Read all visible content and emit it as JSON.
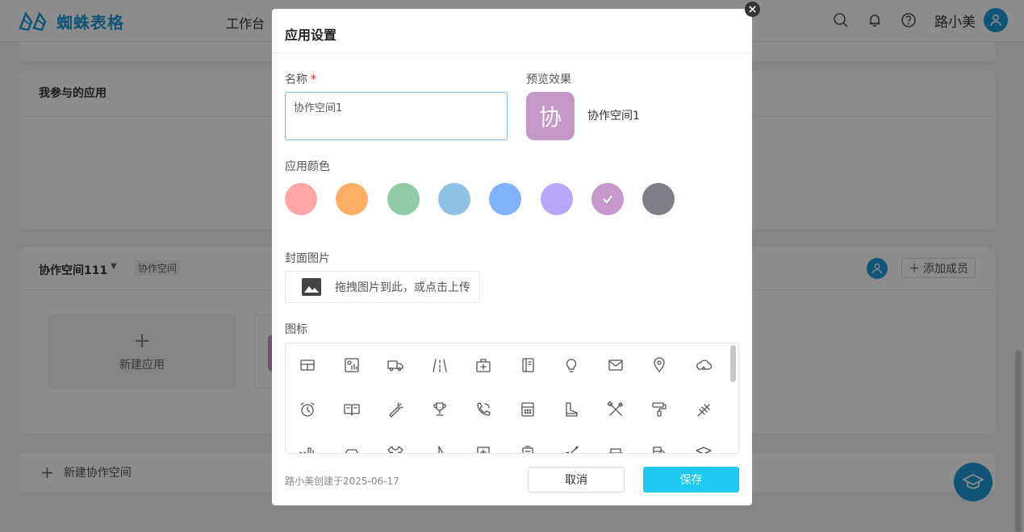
{
  "header": {
    "brand": "蜘蛛表格",
    "nav_workbench": "工作台",
    "user_name": "路小美",
    "icons": [
      "search-icon",
      "bell-icon",
      "help-icon",
      "user-icon"
    ],
    "brand_color": "#1e9bd8"
  },
  "sections": {
    "my_apps_title": "我参与的应用",
    "space": {
      "name": "协作空间111",
      "tag": "协作空间",
      "add_member": "添加成员",
      "new_app": "新建应用"
    },
    "new_space": "新建协作空间"
  },
  "modal": {
    "title": "应用设置",
    "name_label": "名称",
    "required_mark": "*",
    "name_value": "协作空间1",
    "preview_label": "预览效果",
    "preview_char": "协",
    "preview_name": "协作空间1",
    "color_label": "应用颜色",
    "colors": [
      "#fea7a6",
      "#fcae66",
      "#90cba6",
      "#8fc1e4",
      "#7fb2fb",
      "#b9a6fb",
      "#c698c9",
      "#7d7f88"
    ],
    "selected_color_index": 6,
    "cover_label": "封面图片",
    "upload_text": "拖拽图片到此，或点击上传",
    "icon_label": "图标",
    "icons_row1": [
      "table-icon",
      "chart-icon",
      "truck-icon",
      "road-icon",
      "medkit-icon",
      "notebook-icon",
      "lightbulb-icon",
      "mail-icon",
      "location-icon",
      "cloud-icon"
    ],
    "icons_row2": [
      "alarm-icon",
      "book-icon",
      "carrot-icon",
      "trophy-icon",
      "phone-icon",
      "calculator-icon",
      "boot-icon",
      "tools-icon",
      "paint-roller-icon",
      "wheat-icon"
    ],
    "icons_row3": [
      "factory-icon",
      "car-icon",
      "shirt-icon",
      "sail-icon",
      "hospital-icon",
      "building-icon",
      "rocket-icon",
      "sofa-icon",
      "gas-icon",
      "graduation-icon"
    ],
    "created_info": "路小美创建于2025-06-17",
    "cancel_label": "取消",
    "save_label": "保存",
    "save_color": "#1ec8f0"
  }
}
